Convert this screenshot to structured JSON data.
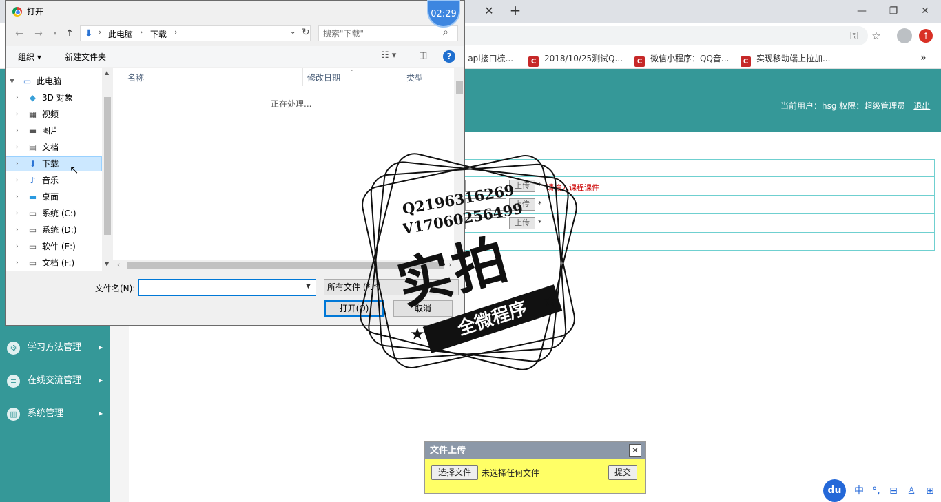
{
  "browser": {
    "tab_close": "✕",
    "new_tab": "+",
    "bookmarks": [
      {
        "label": "-api接口梳..."
      },
      {
        "label": "2018/10/25测试Q..."
      },
      {
        "label": "微信小程序：QQ音..."
      },
      {
        "label": "实现移动端上拉加..."
      }
    ],
    "bookmark_favicon": "C",
    "more_bookmarks": "»"
  },
  "timer": "02:29",
  "app": {
    "user_label": "当前用户：hsg  权限：超级管理员",
    "logout": "退出",
    "sidebar": [
      {
        "label": "学习方法管理",
        "icon": "gear-icon"
      },
      {
        "label": "在线交流管理",
        "icon": "layers-icon"
      },
      {
        "label": "系统管理",
        "icon": "chart-icon"
      }
    ],
    "form": {
      "upload_label": "上传",
      "required_mark": "*",
      "hint": "请输入课程课件"
    }
  },
  "upload_popup": {
    "title": "文件上传",
    "close": "✕",
    "choose_button": "选择文件",
    "no_file": "未选择任何文件",
    "submit": "提交"
  },
  "dialog": {
    "title": "打开",
    "path": [
      "此电脑",
      "下载"
    ],
    "search_placeholder": "搜索\"下载\"",
    "organize": "组织 ▾",
    "new_folder": "新建文件夹",
    "help": "?",
    "tree": [
      {
        "label": "此电脑",
        "icon": "computer-icon"
      },
      {
        "label": "3D 对象",
        "icon": "cube-icon"
      },
      {
        "label": "视频",
        "icon": "video-icon"
      },
      {
        "label": "图片",
        "icon": "picture-icon"
      },
      {
        "label": "文档",
        "icon": "document-icon"
      },
      {
        "label": "下载",
        "icon": "download-icon"
      },
      {
        "label": "音乐",
        "icon": "music-icon"
      },
      {
        "label": "桌面",
        "icon": "desktop-icon"
      },
      {
        "label": "系统 (C:)",
        "icon": "drive-icon"
      },
      {
        "label": "系统 (D:)",
        "icon": "drive-icon"
      },
      {
        "label": "软件 (E:)",
        "icon": "drive-icon"
      },
      {
        "label": "文档 (F:)",
        "icon": "drive-icon"
      }
    ],
    "columns": [
      "名称",
      "修改日期",
      "类型"
    ],
    "status": "正在处理...",
    "filename_label": "文件名(N):",
    "filetype": "所有文件 (*.*)",
    "open": "打开(O)",
    "cancel": "取消"
  },
  "watermark": {
    "line1": "Q2196316269",
    "line2": "V17060256499",
    "big": "实拍",
    "banner": "全微程序"
  },
  "ime": {
    "logo": "du",
    "items": [
      "中",
      "°,",
      "⊟",
      "♙",
      "⊞"
    ]
  }
}
